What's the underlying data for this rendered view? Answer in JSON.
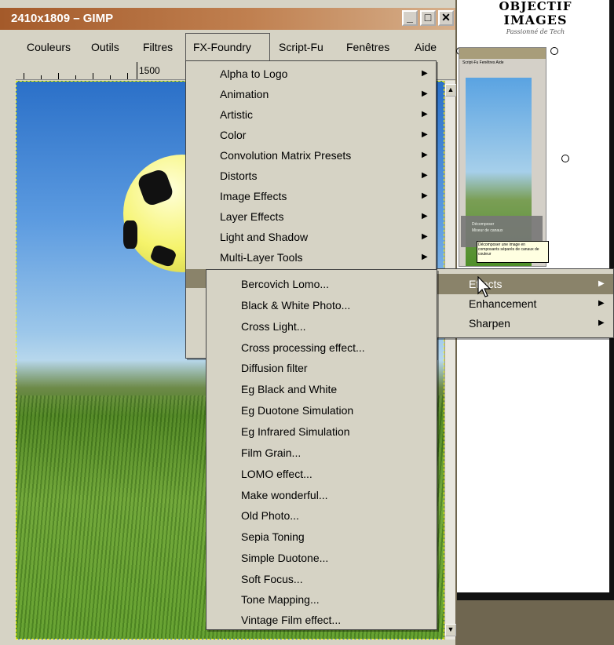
{
  "window": {
    "title": "2410x1809 – GIMP",
    "buttons": {
      "minimize": "_",
      "maximize": "□",
      "close": "✕"
    }
  },
  "menubar": [
    "Couleurs",
    "Outils",
    "Filtres",
    "FX-Foundry",
    "Script-Fu",
    "Fenêtres",
    "Aide"
  ],
  "ruler": {
    "label": "1500"
  },
  "fx_menu": {
    "items": [
      "Alpha to Logo",
      "Animation",
      "Artistic",
      "Color",
      "Convolution Matrix Presets",
      "Distorts",
      "Image Effects",
      "Layer Effects",
      "Light and Shadow",
      "Multi-Layer Tools"
    ]
  },
  "photo_menu": {
    "items": [
      "Effects",
      "Enhancement",
      "Sharpen"
    ],
    "selected": "Effects"
  },
  "effects_menu": {
    "items": [
      "Bercovich Lomo...",
      "Black & White Photo...",
      "Cross Light...",
      "Cross processing effect...",
      "Diffusion filter",
      "Eg Black and White",
      "Eg Duotone Simulation",
      "Eg Infrared Simulation",
      "Film Grain...",
      "LOMO effect...",
      "Make wonderful...",
      "Old Photo...",
      "Sepia Toning",
      "Simple Duotone...",
      "Soft Focus...",
      "Tone Mapping...",
      "Vintage Film effect..."
    ]
  },
  "background": {
    "logo_line1": "OBJECTIF",
    "logo_line2": "IMAGES",
    "logo_line3": "Passionné de Tech",
    "mini_menubar": "Script-Fu  Fenêtres  Aide",
    "mini_menu_items": [
      "Décomposer",
      "Mixeur de canaux"
    ],
    "mini_tooltip": "Décomposer une image en composants séparés de canaux de couleur"
  }
}
